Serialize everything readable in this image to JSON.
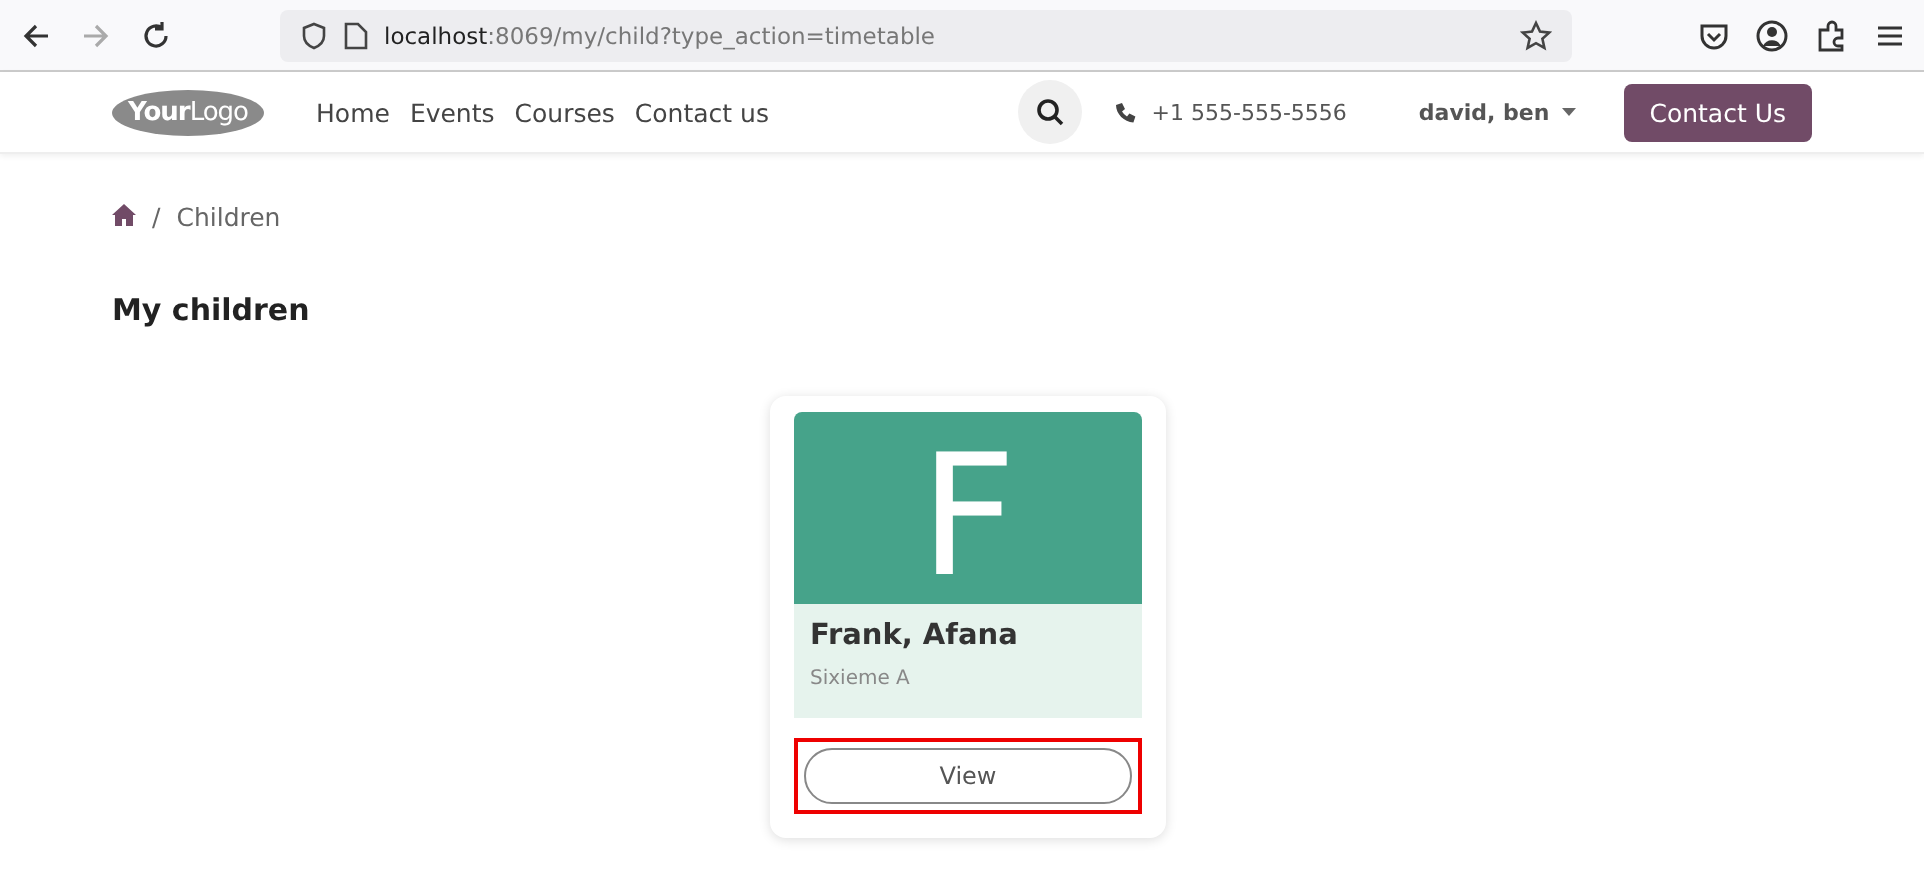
{
  "browser": {
    "url_host": "localhost",
    "url_rest": ":8069/my/child?type_action=timetable"
  },
  "header": {
    "logo": "**Your**Logo",
    "nav": [
      {
        "label": "Home"
      },
      {
        "label": "Events"
      },
      {
        "label": "Courses"
      },
      {
        "label": "Contact us"
      }
    ],
    "phone": "+1 555-555-5556",
    "user": "david, ben",
    "cta": "Contact Us"
  },
  "breadcrumb": {
    "separator": "/",
    "current": "Children"
  },
  "title": "My children",
  "children": [
    {
      "initial": "F",
      "name": "Frank, Afana",
      "class": "Sixieme A",
      "button": "View",
      "highlighted": true
    }
  ]
}
